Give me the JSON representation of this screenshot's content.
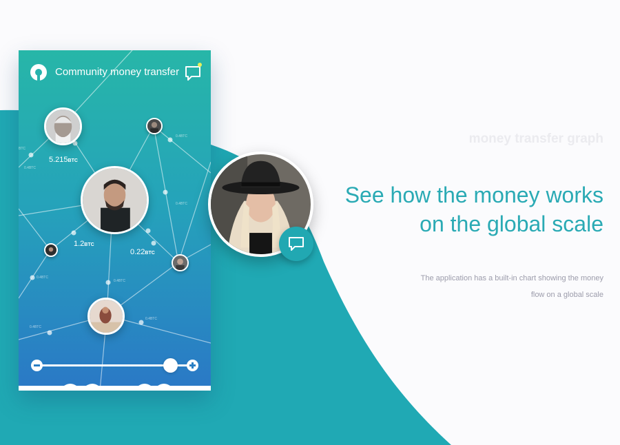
{
  "app": {
    "title": "Community money transfer",
    "header_icons": [
      "logo-icon",
      "chat-icon"
    ],
    "notification_dot_color": "#e7f05a"
  },
  "graph": {
    "amounts": [
      {
        "value": "5.215",
        "unit": "BTC"
      },
      {
        "value": "1.2",
        "unit": "BTC"
      },
      {
        "value": "0.22",
        "unit": "BTC"
      }
    ],
    "edge_labels": [
      "0.4BTC",
      "0.4BTC",
      "0.4BTC",
      "0.4BTC",
      "0.4BTC",
      "0.4BTC",
      "0.4BTC",
      "BTC"
    ]
  },
  "zoom": {
    "minus_icon": "minus-icon",
    "plus_icon": "plus-icon",
    "level": 0.86
  },
  "content": {
    "eyebrow": "money transfer graph",
    "headline_line1": "See how the money works",
    "headline_line2": "on the global scale",
    "subtext_line1": "The application has a built-in chart showing the money",
    "subtext_line2": "flow on a global scale"
  },
  "colors": {
    "accent": "#2aaab4",
    "wave": "#1fa9b4",
    "phone_top": "#27b6a8",
    "phone_bottom": "#2a78c6",
    "background": "#fbfbfd"
  }
}
